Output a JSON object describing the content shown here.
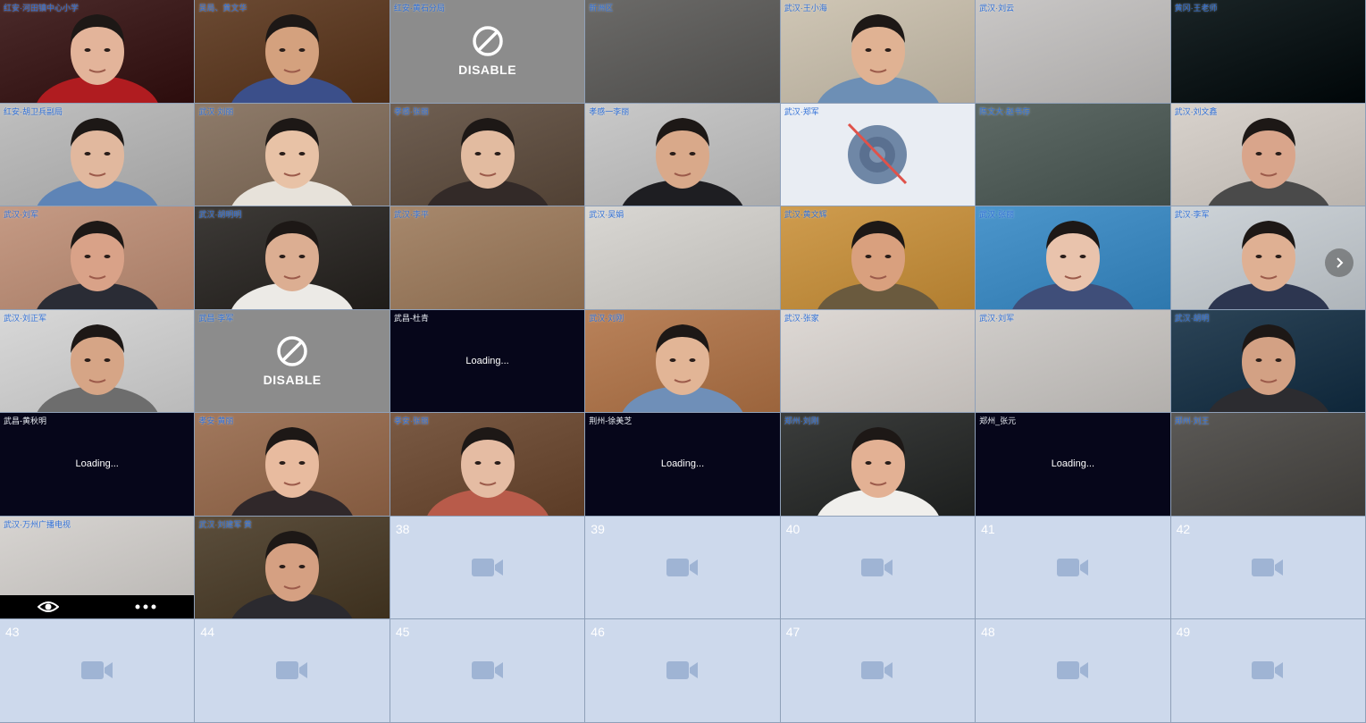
{
  "tiles": [
    {
      "name": "红安·河田镇中心小学",
      "kind": "video",
      "bg": "#4a2a2a",
      "skin": "#e3b49a",
      "shirt": "#b01c20"
    },
    {
      "name": "吴局、黄文华",
      "kind": "video",
      "bg": "#6b4a33",
      "skin": "#d4a17e",
      "shirt": "#3b4f8a"
    },
    {
      "name": "红安·黄石分局",
      "kind": "disable",
      "label": "DISABLE"
    },
    {
      "name": "新洲区",
      "kind": "video",
      "bg": "#6b6a68",
      "skin": null,
      "shirt": null
    },
    {
      "name": "武汉·王小海",
      "kind": "video",
      "bg": "#cfc6b5",
      "skin": "#e0b293",
      "shirt": "#6d8fb5"
    },
    {
      "name": "武汉·刘云",
      "kind": "video",
      "bg": "#c9c7c6",
      "skin": null,
      "shirt": null
    },
    {
      "name": "黄冈·王老师",
      "kind": "video",
      "bg": "#1a2426",
      "skin": null,
      "shirt": null
    },
    {
      "name": "红安·胡卫兵副局",
      "kind": "video",
      "bg": "#bfbfbf",
      "skin": "#e1b89e",
      "shirt": "#5e84b6"
    },
    {
      "name": "武汉·刘丽",
      "kind": "video",
      "bg": "#8e7b6a",
      "skin": "#e8c2a6",
      "shirt": "#e7e2da"
    },
    {
      "name": "孝感·张丽",
      "kind": "video",
      "bg": "#6f5f52",
      "skin": "#e2bba0",
      "shirt": "#332a28"
    },
    {
      "name": "孝感一李丽",
      "kind": "video",
      "bg": "#c9c9c9",
      "skin": "#d9a98a",
      "shirt": "#1e1e22"
    },
    {
      "name": "武汉·郑军",
      "kind": "nocam"
    },
    {
      "name": "陈文大·赵书存",
      "kind": "video",
      "bg": "#5e6a66",
      "skin": null,
      "shirt": null
    },
    {
      "name": "武汉·刘文鑫",
      "kind": "video",
      "bg": "#d8d2cc",
      "skin": "#d9a58b",
      "shirt": "#4a4a4a"
    },
    {
      "name": "武汉·刘军",
      "kind": "video",
      "bg": "#c59a84",
      "skin": "#d9a288",
      "shirt": "#2a2c35"
    },
    {
      "name": "武汉·胡明明",
      "kind": "video",
      "bg": "#3d3a37",
      "skin": "#dcae92",
      "shirt": "#eceae6"
    },
    {
      "name": "武汉·李平",
      "kind": "video",
      "bg": "#a7886c",
      "skin": null,
      "shirt": null
    },
    {
      "name": "武汉·吴娟",
      "kind": "video",
      "bg": "#d9d7d3",
      "skin": null,
      "shirt": null
    },
    {
      "name": "武汉·黄文辉",
      "kind": "video",
      "bg": "#cf9c4e",
      "skin": "#d9a07e",
      "shirt": "#6a5a3e"
    },
    {
      "name": "武汉·张丽",
      "kind": "video",
      "bg": "#4c96cc",
      "skin": "#e9c3ac",
      "shirt": "#3f4e79"
    },
    {
      "name": "武汉·李军",
      "kind": "video",
      "bg": "#cdd3d8",
      "skin": "#dfb093",
      "shirt": "#2d3650"
    },
    {
      "name": "武汉·刘正军",
      "kind": "video",
      "bg": "#d8d8d8",
      "skin": "#d6a586",
      "shirt": "#6d6d6d"
    },
    {
      "name": "武昌·李军",
      "kind": "disable",
      "label": "DISABLE"
    },
    {
      "name": "武昌-杜青",
      "kind": "loading",
      "label": "Loading..."
    },
    {
      "name": "武汉·刘刚",
      "kind": "video",
      "bg": "#b9825a",
      "skin": "#e2b596",
      "shirt": "#6f8fb8"
    },
    {
      "name": "武汉·张家",
      "kind": "video",
      "bg": "#ded9d5",
      "skin": null,
      "shirt": null
    },
    {
      "name": "武汉·刘军",
      "kind": "video",
      "bg": "#d0cdca",
      "skin": null,
      "shirt": null
    },
    {
      "name": "武汉·胡明",
      "kind": "video",
      "bg": "#2c4457",
      "skin": "#d3a184",
      "shirt": "#2c2c30"
    },
    {
      "name": "武昌-黄秋明",
      "kind": "loading",
      "label": "Loading..."
    },
    {
      "name": "孝安·黄丽",
      "kind": "video",
      "bg": "#a1785d",
      "skin": "#e8bb9f",
      "shirt": "#30282a"
    },
    {
      "name": "孝安·张丽",
      "kind": "video",
      "bg": "#7a5a44",
      "skin": "#e5bca3",
      "shirt": "#b85b4a"
    },
    {
      "name": "荆州-徐美芝",
      "kind": "loading",
      "label": "Loading..."
    },
    {
      "name": "郑州·刘刚",
      "kind": "video",
      "bg": "#3b3d3c",
      "skin": "#e3b194",
      "shirt": "#f0efec"
    },
    {
      "name": "郑州_张元",
      "kind": "loading",
      "label": "Loading..."
    },
    {
      "name": "郑州·刘王",
      "kind": "video",
      "bg": "#5b5956",
      "skin": null,
      "shirt": null
    },
    {
      "name": "武汉·万州广播电视",
      "kind": "video_bar",
      "bg": "#d7d4d1",
      "skin": null,
      "shirt": null
    },
    {
      "name": "武汉·刘建军 黄",
      "kind": "video",
      "bg": "#5b4e3c",
      "skin": "#d5a082",
      "shirt": "#2b2a2f"
    },
    {
      "kind": "slot",
      "num": "38"
    },
    {
      "kind": "slot",
      "num": "39"
    },
    {
      "kind": "slot",
      "num": "40"
    },
    {
      "kind": "slot",
      "num": "41"
    },
    {
      "kind": "slot",
      "num": "42"
    },
    {
      "kind": "slot",
      "num": "43"
    },
    {
      "kind": "slot",
      "num": "44"
    },
    {
      "kind": "slot",
      "num": "45"
    },
    {
      "kind": "slot",
      "num": "46"
    },
    {
      "kind": "slot",
      "num": "47"
    },
    {
      "kind": "slot",
      "num": "48"
    },
    {
      "kind": "slot",
      "num": "49"
    }
  ],
  "icons": {
    "disable": "no-entry-icon",
    "slot": "video-camera-icon",
    "nocam": "camera-off-icon",
    "next": "chevron-right-icon",
    "bar_left": "eye-icon",
    "bar_right": "more-dots-icon"
  },
  "colors": {
    "name_text": "#2f6fd6",
    "slot_bg": "#cdd9ec",
    "disable_bg": "#8c8c8c",
    "loading_bg": "#06061a"
  }
}
